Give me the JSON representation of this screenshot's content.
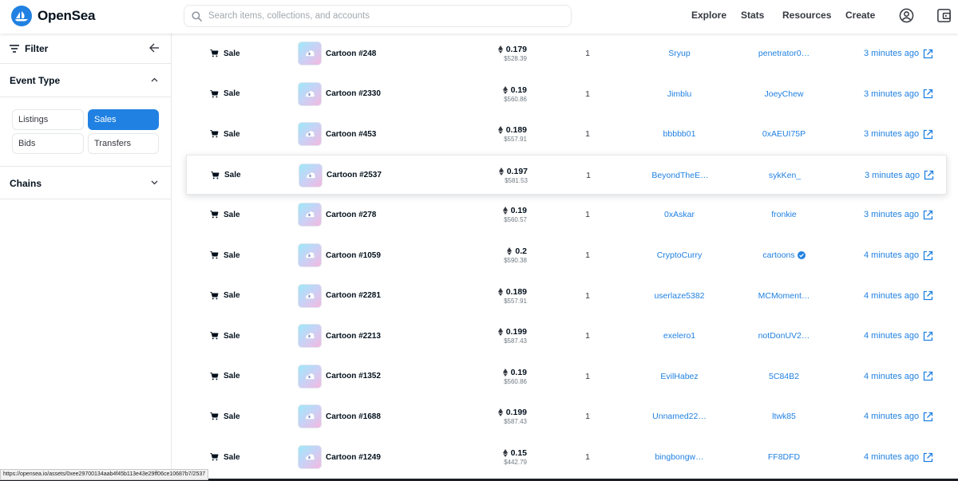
{
  "header": {
    "brand": "OpenSea",
    "search_placeholder": "Search items, collections, and accounts",
    "nav": [
      "Explore",
      "Stats",
      "Resources",
      "Create"
    ]
  },
  "sidebar": {
    "filter_label": "Filter",
    "event_type_label": "Event Type",
    "chips": [
      "Listings",
      "Sales",
      "Bids",
      "Transfers"
    ],
    "active_chip": "Sales",
    "chains_label": "Chains"
  },
  "colors": {
    "accent": "#2081e2",
    "text": "#04111d",
    "muted": "#707a83"
  },
  "rows": [
    {
      "event": "Sale",
      "item": "Cartoon #248",
      "eth": "0.179",
      "usd": "$528.39",
      "qty": "1",
      "from": "Sryup",
      "to": "penetrator0…",
      "time": "3 minutes ago"
    },
    {
      "event": "Sale",
      "item": "Cartoon #2330",
      "eth": "0.19",
      "usd": "$560.86",
      "qty": "1",
      "from": "Jimblu",
      "to": "JoeyChew",
      "time": "3 minutes ago"
    },
    {
      "event": "Sale",
      "item": "Cartoon #453",
      "eth": "0.189",
      "usd": "$557.91",
      "qty": "1",
      "from": "bbbbb01",
      "to": "0xAEUI75P",
      "time": "3 minutes ago"
    },
    {
      "event": "Sale",
      "item": "Cartoon #2537",
      "eth": "0.197",
      "usd": "$581.53",
      "qty": "1",
      "from": "BeyondTheE…",
      "to": "sykKen_",
      "time": "3 minutes ago"
    },
    {
      "event": "Sale",
      "item": "Cartoon #278",
      "eth": "0.19",
      "usd": "$560.57",
      "qty": "1",
      "from": "0xAskar",
      "to": "fronkie",
      "time": "3 minutes ago"
    },
    {
      "event": "Sale",
      "item": "Cartoon #1059",
      "eth": "0.2",
      "usd": "$590.38",
      "qty": "1",
      "from": "CryptoCurry",
      "to": "cartoons",
      "time": "4 minutes ago"
    },
    {
      "event": "Sale",
      "item": "Cartoon #2281",
      "eth": "0.189",
      "usd": "$557.91",
      "qty": "1",
      "from": "userlaze5382",
      "to": "MCMoment…",
      "time": "4 minutes ago"
    },
    {
      "event": "Sale",
      "item": "Cartoon #2213",
      "eth": "0.199",
      "usd": "$587.43",
      "qty": "1",
      "from": "exelero1",
      "to": "notDonUV2…",
      "time": "4 minutes ago"
    },
    {
      "event": "Sale",
      "item": "Cartoon #1352",
      "eth": "0.19",
      "usd": "$560.86",
      "qty": "1",
      "from": "EvilHabez",
      "to": "5C84B2",
      "time": "4 minutes ago"
    },
    {
      "event": "Sale",
      "item": "Cartoon #1688",
      "eth": "0.199",
      "usd": "$587.43",
      "qty": "1",
      "from": "Unnamed22…",
      "to": "ltwk85",
      "time": "4 minutes ago"
    },
    {
      "event": "Sale",
      "item": "Cartoon #1249",
      "eth": "0.15",
      "usd": "$442.79",
      "qty": "1",
      "from": "bingbongw…",
      "to": "FF8DFD",
      "time": "4 minutes ago"
    }
  ],
  "status_url": "https://opensea.io/assets/0xee29700134aab4f45b113e43e29ff06ce10687b7/2537"
}
